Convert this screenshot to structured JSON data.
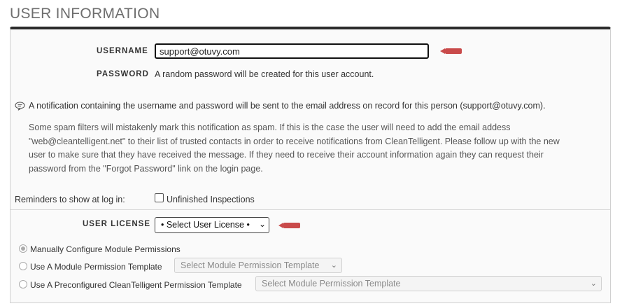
{
  "page": {
    "title": "USER INFORMATION"
  },
  "username": {
    "label": "USERNAME",
    "value": "support@otuvy.com"
  },
  "password": {
    "label": "PASSWORD",
    "text": "A random password will be created for this user account."
  },
  "notification": {
    "text": "A notification containing the username and password will be sent to the email address on record for this person (support@otuvy.com).",
    "spam_note": "Some spam filters will mistakenly mark this notification as spam. If this is the case the user will need to add the email addess \"web@cleantelligent.net\" to their list of trusted contacts in order to receive notifications from CleanTelligent. Please follow up with the new user to make sure that they have received the message. If they need to receive their account information again they can request their password from the \"Forgot Password\" link on the login page."
  },
  "reminders": {
    "label": "Reminders to show at log in:",
    "option": "Unfinished Inspections",
    "checked": false
  },
  "license": {
    "label": "USER LICENSE",
    "selected": "• Select User License •"
  },
  "permissions": {
    "manual": {
      "label": "Manually Configure Module Permissions",
      "checked": true
    },
    "template": {
      "label": "Use A Module Permission Template",
      "select": "Select Module Permission Template"
    },
    "preconfigured": {
      "label": "Use A Preconfigured CleanTelligent Permission Template",
      "select": "Select Module Permission Template"
    }
  },
  "colors": {
    "required_marker": "#c94a4a",
    "panel_top_border": "#2b2b2b"
  }
}
